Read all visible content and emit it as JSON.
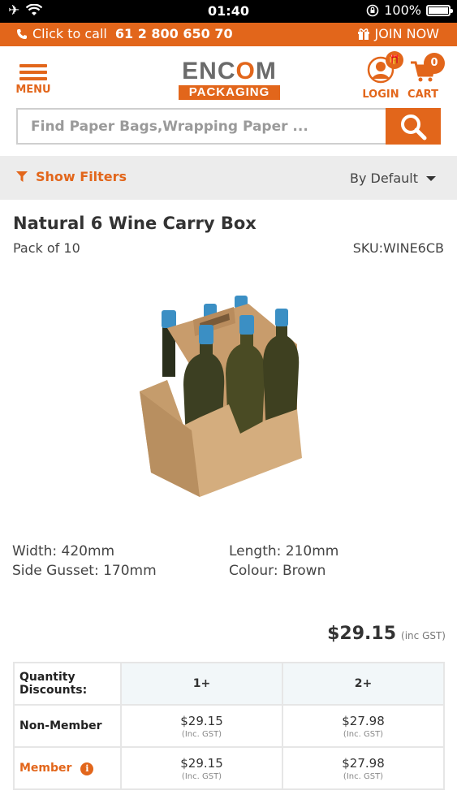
{
  "status_bar": {
    "time": "01:40",
    "battery": "100%"
  },
  "topbar": {
    "call_text": "Click to call",
    "call_number": "61 2 800 650 70",
    "join_label": "JOIN NOW"
  },
  "header": {
    "menu_label": "MENU",
    "logo_top": "ENCOM",
    "logo_bottom": "PACKAGING",
    "login_label": "LOGIN",
    "cart_label": "CART",
    "cart_count": "0"
  },
  "search": {
    "placeholder": "Find Paper Bags,Wrapping Paper ..."
  },
  "filterbar": {
    "filters_label": "Show Filters",
    "sort_label": "By Default"
  },
  "product": {
    "title": "Natural 6 Wine Carry Box",
    "pack": "Pack of 10",
    "sku": "SKU:WINE6CB",
    "specs": {
      "width": "Width: 420mm",
      "length": "Length: 210mm",
      "side_gusset": "Side Gusset: 170mm",
      "colour": "Colour: Brown"
    },
    "price": "$29.15",
    "price_note": "(inc GST)"
  },
  "discounts": {
    "header_label": "Quantity Discounts:",
    "columns": [
      "1+",
      "2+"
    ],
    "rows": [
      {
        "label": "Non-Member",
        "values": [
          "$29.15",
          "$27.98"
        ],
        "subs": [
          "(Inc. GST)",
          "(Inc. GST)"
        ]
      },
      {
        "label": "Member",
        "values": [
          "$29.15",
          "$27.98"
        ],
        "subs": [
          "(Inc. GST)",
          "(Inc. GST)"
        ]
      }
    ]
  },
  "colors": {
    "accent": "#e2661b",
    "logo_grey": "#6b6b6b",
    "filter_bg": "#ececec"
  }
}
